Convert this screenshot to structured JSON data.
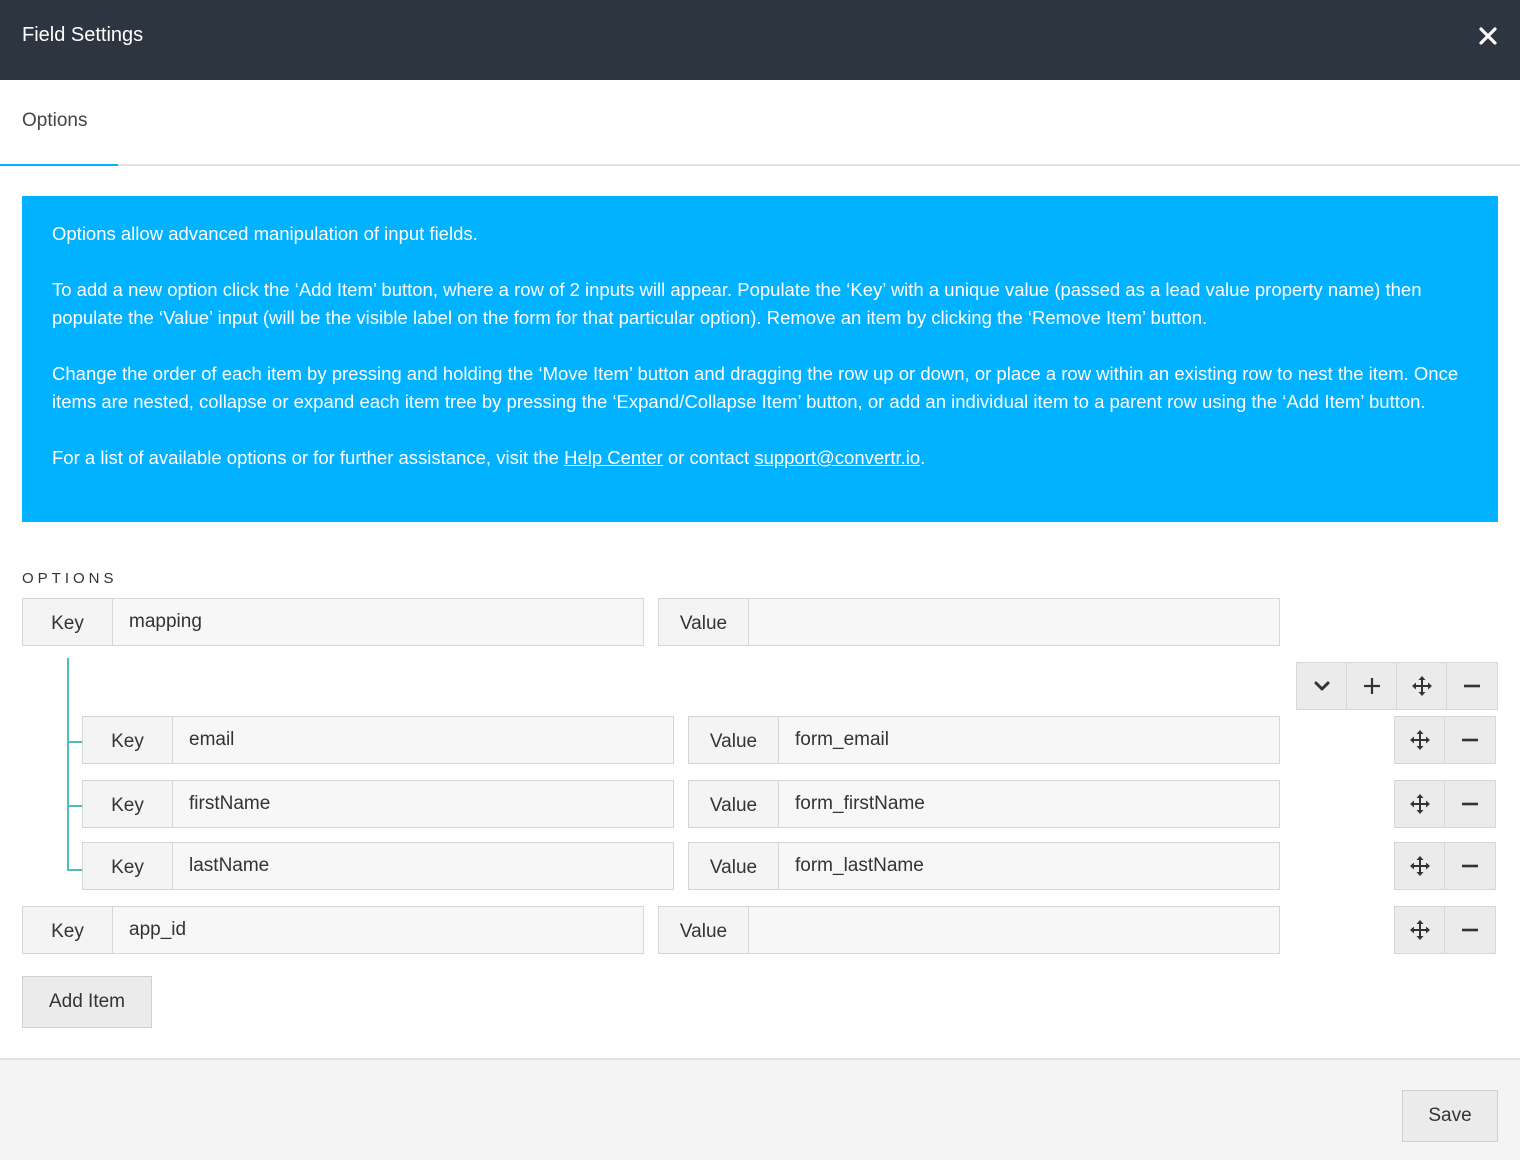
{
  "header": {
    "title": "Field Settings",
    "close_icon": "close-icon"
  },
  "tabs": [
    {
      "label": "Options",
      "active": true
    }
  ],
  "info": {
    "p1": "Options allow advanced manipulation of input fields.",
    "p2": "To add a new option click the ‘Add Item’ button, where a row of 2 inputs will appear. Populate the ‘Key’ with a unique value (passed as a lead value property name) then populate the ‘Value’ input (will be the visible label on the form for that particular option). Remove an item by clicking the ‘Remove Item’ button.",
    "p3": "Change the order of each item by pressing and holding the ‘Move Item’ button and dragging the row up or down, or place a row within an existing row to nest the item. Once items are nested, collapse or expand each item tree by pressing the ‘Expand/Collapse Item’ button, or add an individual item to a parent row using the ‘Add Item’ button.",
    "p4_prefix": "For a list of available options or for further assistance, visit the ",
    "help_link": "Help Center",
    "p4_middle": " or contact ",
    "support_link": "support@convertr.io",
    "p4_suffix": "."
  },
  "options": {
    "section_label": "OPTIONS",
    "key_label": "Key",
    "value_label": "Value",
    "items": [
      {
        "key": "mapping",
        "value": "",
        "children": [
          {
            "key": "email",
            "value": "form_email"
          },
          {
            "key": "firstName",
            "value": "form_firstName"
          },
          {
            "key": "lastName",
            "value": "form_lastName"
          }
        ]
      },
      {
        "key": "app_id",
        "value": ""
      }
    ],
    "icons": {
      "collapse": "chevron-down-icon",
      "add": "plus-icon",
      "move": "move-icon",
      "remove": "minus-icon"
    },
    "tree_line_color": "#4dbfb4"
  },
  "actions": {
    "add_item_label": "Add Item",
    "save_label": "Save"
  },
  "colors": {
    "header_bg": "#2d3540",
    "info_bg": "#00b2ff",
    "tab_indicator": "#00b2ff"
  }
}
